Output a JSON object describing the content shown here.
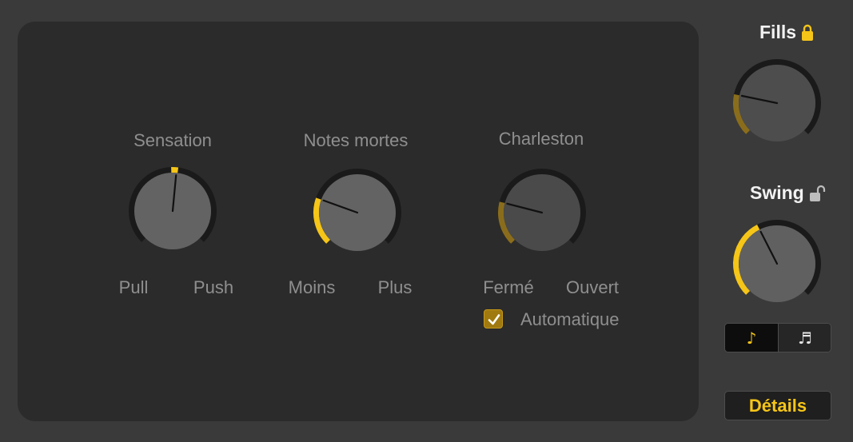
{
  "panel": {
    "sensation": {
      "title": "Sensation",
      "min_label": "Pull",
      "max_label": "Push",
      "value": 0.52
    },
    "notes_mortes": {
      "title": "Notes mortes",
      "min_label": "Moins",
      "max_label": "Plus",
      "value": 0.24
    },
    "charleston": {
      "title": "Charleston",
      "min_label": "Fermé",
      "max_label": "Ouvert",
      "value": 0.22,
      "auto_label": "Automatique",
      "auto_checked": true
    }
  },
  "side": {
    "fills": {
      "title": "Fills",
      "locked": true,
      "value": 0.21
    },
    "swing": {
      "title": "Swing",
      "locked": false,
      "value": 0.4
    },
    "note_buttons": [
      {
        "icon": "eighth-note-icon",
        "glyph": "♪",
        "selected": true
      },
      {
        "icon": "sixteenth-note-icon",
        "glyph": "♬",
        "selected": false
      }
    ],
    "details_label": "Détails"
  },
  "colors": {
    "accent": "#f5c518",
    "accent_dim": "#8a6d1c",
    "panel_bg": "#2b2b2b",
    "window_bg": "#3a3a3a"
  }
}
